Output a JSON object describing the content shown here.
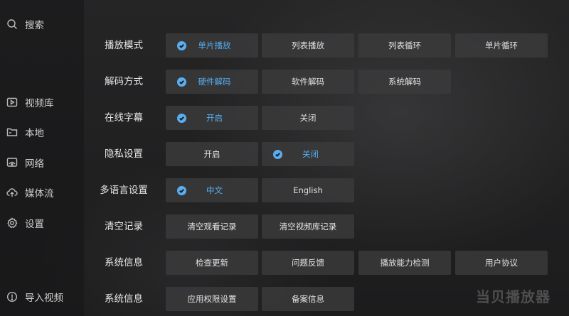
{
  "sidebar": {
    "items": [
      {
        "label": "搜索",
        "icon": "search-icon"
      },
      {
        "label": "视频库",
        "icon": "video-library-icon"
      },
      {
        "label": "本地",
        "icon": "folder-icon"
      },
      {
        "label": "网络",
        "icon": "network-icon"
      },
      {
        "label": "媒体流",
        "icon": "cloud-upload-icon"
      },
      {
        "label": "设置",
        "icon": "gear-icon"
      },
      {
        "label": "导入视频",
        "icon": "import-icon"
      }
    ]
  },
  "settings": {
    "rows": [
      {
        "label": "播放模式",
        "options": [
          "单片播放",
          "列表播放",
          "列表循环",
          "单片循环"
        ],
        "selected": 0
      },
      {
        "label": "解码方式",
        "options": [
          "硬件解码",
          "软件解码",
          "系统解码"
        ],
        "selected": 0
      },
      {
        "label": "在线字幕",
        "options": [
          "开启",
          "关闭"
        ],
        "selected": 0
      },
      {
        "label": "隐私设置",
        "options": [
          "开启",
          "关闭"
        ],
        "selected": 1
      },
      {
        "label": "多语言设置",
        "options": [
          "中文",
          "English"
        ],
        "selected": 0
      },
      {
        "label": "清空记录",
        "options": [
          "清空观看记录",
          "清空视频库记录"
        ],
        "selected": -1
      },
      {
        "label": "系统信息",
        "options": [
          "检查更新",
          "问题反馈",
          "播放能力检测",
          "用户协议"
        ],
        "selected": -1
      },
      {
        "label": "系统信息",
        "options": [
          "应用权限设置",
          "备案信息"
        ],
        "selected": -1
      }
    ]
  },
  "watermark": "当贝播放器",
  "colors": {
    "accent": "#56aef2",
    "option_bg": "#3a3a3c",
    "background": "#1f1f20"
  }
}
